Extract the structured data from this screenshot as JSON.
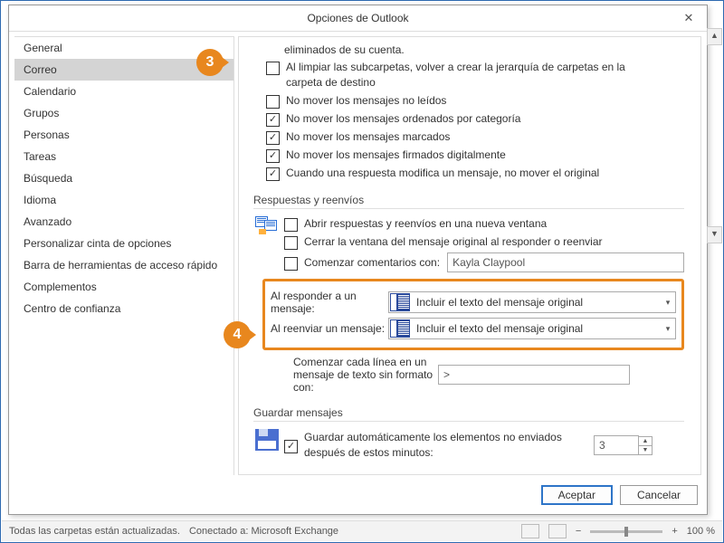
{
  "title": "Opciones de Outlook",
  "badges": {
    "b3": "3",
    "b4": "4"
  },
  "sidebar": [
    "General",
    "Correo",
    "Calendario",
    "Grupos",
    "Personas",
    "Tareas",
    "Búsqueda",
    "Idioma",
    "Avanzado",
    "Personalizar cinta de opciones",
    "Barra de herramientas de acceso rápido",
    "Complementos",
    "Centro de confianza"
  ],
  "top": {
    "l0": "eliminados de su cuenta.",
    "l1": "Al limpiar las subcarpetas, volver a crear la jerarquía de carpetas en la carpeta de destino",
    "l2": "No mover los mensajes no leídos",
    "l3": "No mover los mensajes ordenados por categoría",
    "l4": "No mover los mensajes marcados",
    "l5": "No mover los mensajes firmados digitalmente",
    "l6": "Cuando una respuesta modifica un mensaje, no mover el original"
  },
  "sec1": "Respuestas y reenvíos",
  "rr": {
    "c1": "Abrir respuestas y reenvíos en una nueva ventana",
    "c2": "Cerrar la ventana del mensaje original al responder o reenviar",
    "c3lbl": "Comenzar comentarios con:",
    "c3val": "Kayla Claypool",
    "replyLbl": "Al responder a un mensaje:",
    "replyVal": "Incluir el texto del mensaje original",
    "fwdLbl": "Al reenviar un mensaje:",
    "fwdVal": "Incluir el texto del mensaje original",
    "plainLbl": "Comenzar cada línea en un mensaje de texto sin formato con:",
    "plainVal": ">"
  },
  "sec2": "Guardar mensajes",
  "save": {
    "c1": "Guardar automáticamente los elementos no enviados después de estos minutos:",
    "val": "3"
  },
  "buttons": {
    "ok": "Aceptar",
    "cancel": "Cancelar"
  },
  "status": {
    "folders": "Todas las carpetas están actualizadas.",
    "conn": "Conectado a: Microsoft Exchange",
    "zoom": "100 %"
  }
}
